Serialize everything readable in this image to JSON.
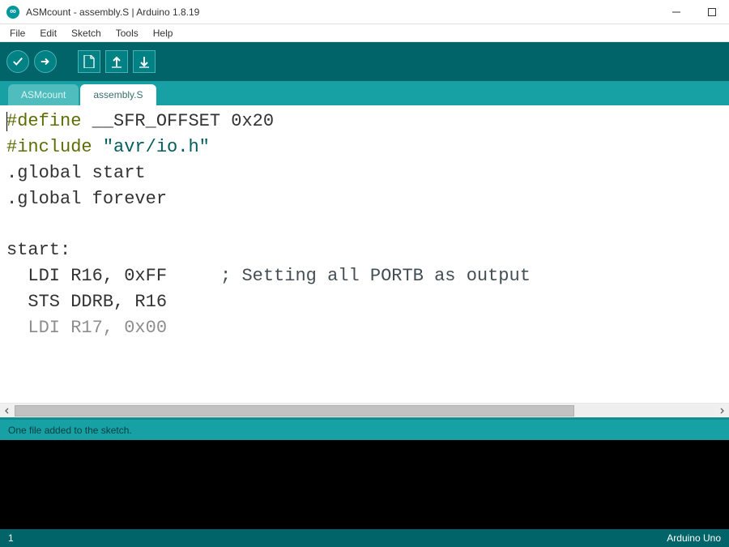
{
  "window": {
    "title": "ASMcount - assembly.S | Arduino 1.8.19"
  },
  "menu": {
    "items": [
      "File",
      "Edit",
      "Sketch",
      "Tools",
      "Help"
    ]
  },
  "toolbar": {
    "verify_tooltip": "Verify",
    "upload_tooltip": "Upload",
    "new_tooltip": "New",
    "open_tooltip": "Open",
    "save_tooltip": "Save"
  },
  "tabs": {
    "items": [
      {
        "label": "ASMcount",
        "active": false
      },
      {
        "label": "assembly.S",
        "active": true
      }
    ]
  },
  "editor": {
    "lines": {
      "l1_directive": "#define",
      "l1_rest": " __SFR_OFFSET 0x20",
      "l2_directive": "#include",
      "l2_gap": " ",
      "l2_string": "\"avr/io.h\"",
      "l3": ".global start",
      "l4": ".global forever",
      "l5": " ",
      "l6": "start:",
      "l7_code": "  LDI R16, 0xFF     ",
      "l7_comment": "; Setting all PORTB as output",
      "l8": "  STS DDRB, R16",
      "l9": "  LDI R17, 0x00"
    }
  },
  "status": {
    "message": "One file added to the sketch."
  },
  "console": {
    "text": ""
  },
  "footer": {
    "line_number": "1",
    "board": "Arduino Uno"
  }
}
